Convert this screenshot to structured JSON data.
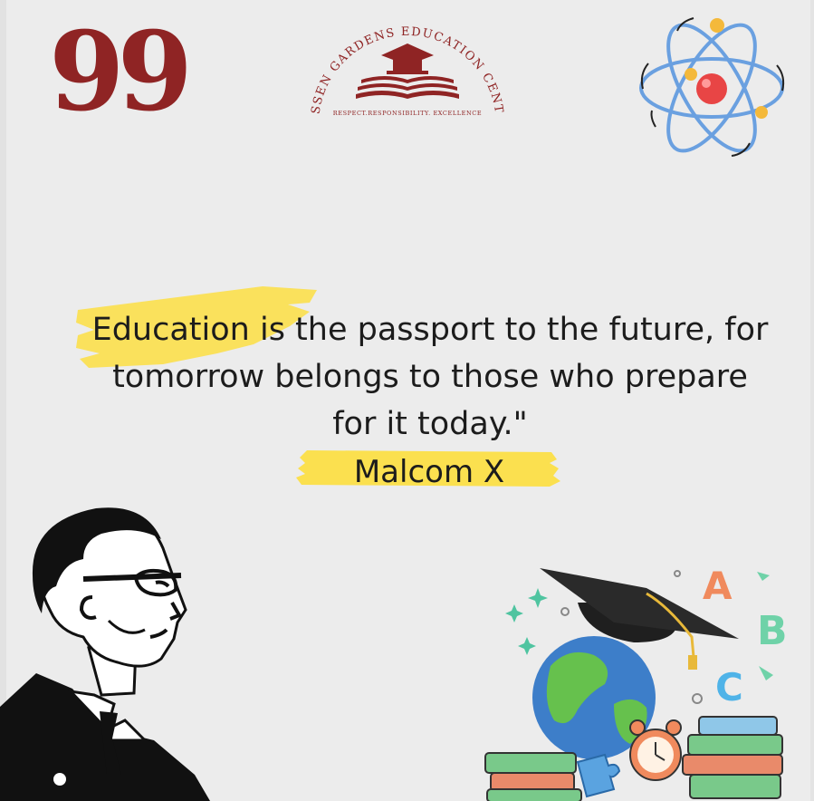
{
  "logo": {
    "arc_text": "RESSEN GARDENS EDUCATION CENTER",
    "motto": "RESPECT.RESPONSIBILITY. EXCELLENCE"
  },
  "quote": {
    "mark": "99",
    "lines": [
      "Education is the passport to the future, for",
      "tomorrow belongs to those who prepare",
      "for it today.\""
    ],
    "author": "Malcom X"
  },
  "illustration": {
    "letters": [
      "A",
      "B",
      "C"
    ]
  },
  "colors": {
    "background": "#ececec",
    "brand": "#8f2424",
    "highlight": "#fbe04f",
    "text": "#1c1c1c"
  }
}
